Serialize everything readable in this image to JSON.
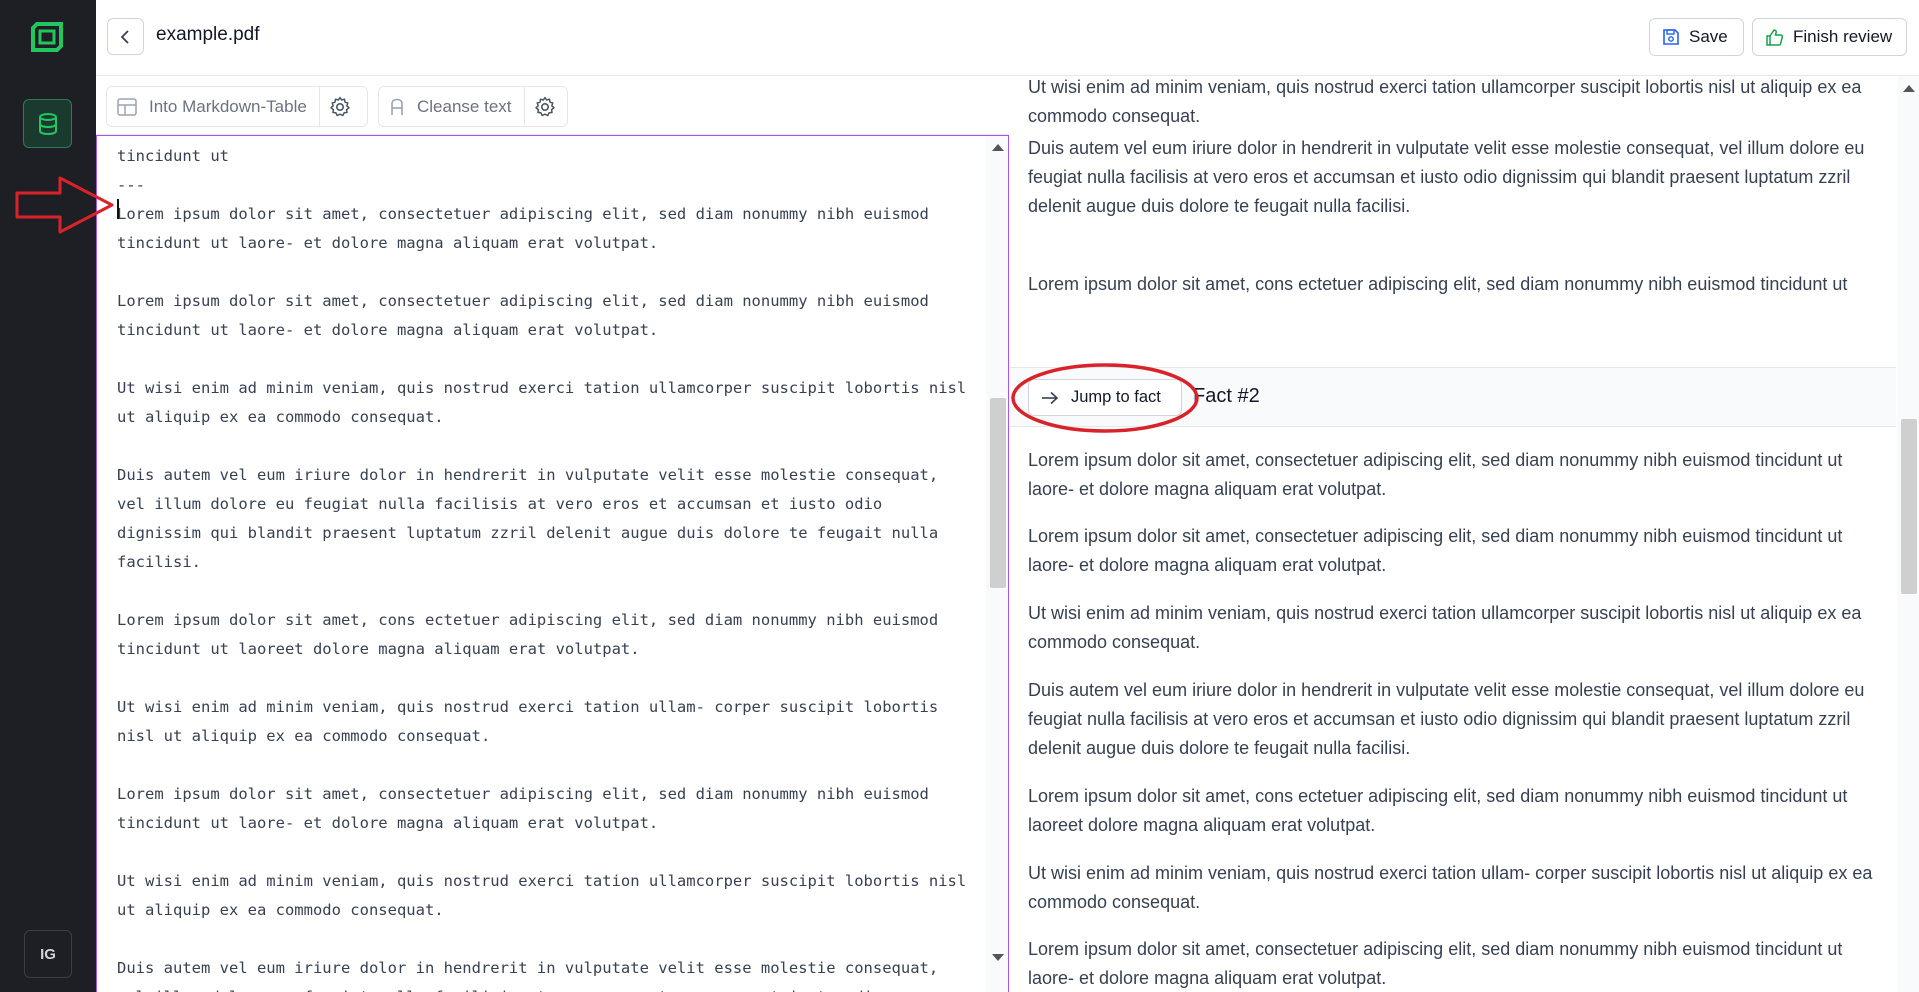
{
  "header": {
    "file_name": "example.pdf",
    "save_label": "Save",
    "finish_label": "Finish review"
  },
  "sidebar": {
    "user_initials": "IG"
  },
  "toolbar": {
    "markdown_table_label": "Into Markdown-Table",
    "cleanse_text_label": "Cleanse text"
  },
  "editor": {
    "lines": [
      "tincidunt ut",
      "---",
      "Lorem ipsum dolor sit amet, consectetuer adipiscing elit, sed diam nonummy nibh euismod",
      "tincidunt ut laore- et dolore magna aliquam erat volutpat.",
      "",
      "Lorem ipsum dolor sit amet, consectetuer adipiscing elit, sed diam nonummy nibh euismod",
      "tincidunt ut laore- et dolore magna aliquam erat volutpat.",
      "",
      "Ut wisi enim ad minim veniam, quis nostrud exerci tation ullamcorper suscipit lobortis nisl",
      "ut aliquip ex ea commodo consequat.",
      "",
      "Duis autem vel eum iriure dolor in hendrerit in vulputate velit esse molestie consequat,",
      "vel illum dolore eu feugiat nulla facilisis at vero eros et accumsan et iusto odio",
      "dignissim qui blandit praesent luptatum zzril delenit augue duis dolore te feugait nulla",
      "facilisi.",
      "",
      "Lorem ipsum dolor sit amet, cons ectetuer adipiscing elit, sed diam nonummy nibh euismod",
      "tincidunt ut laoreet dolore magna aliquam erat volutpat.",
      "",
      "Ut wisi enim ad minim veniam, quis nostrud exerci tation ullam- corper suscipit lobortis",
      "nisl ut aliquip ex ea commodo consequat.",
      "",
      "Lorem ipsum dolor sit amet, consectetuer adipiscing elit, sed diam nonummy nibh euismod",
      "tincidunt ut laore- et dolore magna aliquam erat volutpat.",
      "",
      "Ut wisi enim ad minim veniam, quis nostrud exerci tation ullamcorper suscipit lobortis nisl",
      "ut aliquip ex ea commodo consequat.",
      "",
      "Duis autem vel eum iriure dolor in hendrerit in vulputate velit esse molestie consequat,",
      "vel illum dolore eu feugiat nulla facilisis at vero eros et accumsan et iusto odio"
    ]
  },
  "facts": {
    "previous_paragraphs": [
      "Ut wisi enim ad minim veniam, quis nostrud exerci tation ullamcorper suscipit lobortis nisl ut aliquip ex ea commodo consequat.",
      "Duis autem vel eum iriure dolor in hendrerit in vulputate velit esse molestie consequat, vel illum dolore eu feugiat nulla facilisis at vero eros et accumsan et iusto odio dignissim qui blandit praesent luptatum zzril delenit augue duis dolore te feugait nulla facilisi.",
      "Lorem ipsum dolor sit amet, cons ectetuer adipiscing elit, sed diam nonummy nibh euismod tincidunt ut"
    ],
    "jump_label": "Jump to fact",
    "fact_title": "Fact #2",
    "fact_paragraphs": [
      "Lorem ipsum dolor sit amet, consectetuer adipiscing elit, sed diam nonummy nibh euismod tincidunt ut laore- et dolore magna aliquam erat volutpat.",
      "Lorem ipsum dolor sit amet, consectetuer adipiscing elit, sed diam nonummy nibh euismod tincidunt ut laore- et dolore magna aliquam erat volutpat.",
      "Ut wisi enim ad minim veniam, quis nostrud exerci tation ullamcorper suscipit lobortis nisl ut aliquip ex ea commodo consequat.",
      "Duis autem vel eum iriure dolor in hendrerit in vulputate velit esse molestie consequat, vel illum dolore eu feugiat nulla facilisis at vero eros et accumsan et iusto odio dignissim qui blandit praesent luptatum zzril delenit augue duis dolore te feugait nulla facilisi.",
      "Lorem ipsum dolor sit amet, cons ectetuer adipiscing elit, sed diam nonummy nibh euismod tincidunt ut laoreet dolore magna aliquam erat volutpat.",
      "Ut wisi enim ad minim veniam, quis nostrud exerci tation ullam- corper suscipit lobortis nisl ut aliquip ex ea commodo consequat.",
      "Lorem ipsum dolor sit amet, consectetuer adipiscing elit, sed diam nonummy nibh euismod tincidunt ut laore- et dolore magna aliquam erat volutpat."
    ]
  },
  "colors": {
    "sidebar_bg": "#1d1f24",
    "brand_green": "#22c55e",
    "editor_focus_border": "#a855f7",
    "annotation_red": "#d9232a"
  },
  "icons": {
    "logo": "app-logo-icon",
    "nav": "database-icon",
    "back": "chevron-left-icon",
    "save": "floppy-disk-icon",
    "finish": "thumbs-up-icon",
    "markdown_table": "table-icon",
    "cleanse": "text-cleanse-icon",
    "settings": "gear-icon",
    "jump": "arrow-right-icon"
  }
}
